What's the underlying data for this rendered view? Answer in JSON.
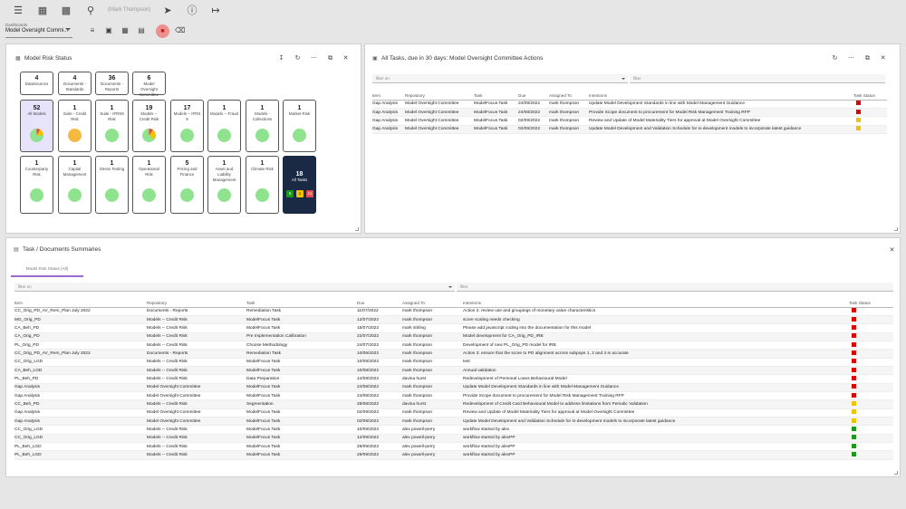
{
  "topbar": {
    "search_placeholder": "(Mark Thompson)",
    "icons": [
      "menu-icon",
      "dashboard-icon",
      "chart-icon",
      "search-icon",
      "nav-icon",
      "help-icon",
      "logout-icon"
    ]
  },
  "dashboard": {
    "label": "Dashboards",
    "value": "Model Oversight Commi..."
  },
  "risk_panel": {
    "title": "Model Risk Status",
    "summary": [
      {
        "count": "4",
        "label": "DataSources"
      },
      {
        "count": "4",
        "label": "Documents - Standards"
      },
      {
        "count": "36",
        "label": "Documents - Reports"
      },
      {
        "count": "6",
        "label": "Model Oversight Committee"
      }
    ],
    "tiles_row1": [
      {
        "count": "52",
        "label": "All Models"
      },
      {
        "count": "1",
        "label": "Suite - Credit Risk"
      },
      {
        "count": "1",
        "label": "Suite - IFRS9 Risk"
      },
      {
        "count": "19",
        "label": "Models -- Credit Risk"
      },
      {
        "count": "17",
        "label": "Models -- IFRS 9"
      },
      {
        "count": "1",
        "label": "Models -- Fraud"
      },
      {
        "count": "1",
        "label": "Models - Collections"
      },
      {
        "count": "1",
        "label": "Market Risk"
      }
    ],
    "tiles_row2": [
      {
        "count": "1",
        "label": "Counterparty Risk"
      },
      {
        "count": "1",
        "label": "Capital Management"
      },
      {
        "count": "1",
        "label": "Stress Testing"
      },
      {
        "count": "1",
        "label": "Operational Risk"
      },
      {
        "count": "5",
        "label": "Pricing and Finance"
      },
      {
        "count": "1",
        "label": "Asset and Liability Management"
      },
      {
        "count": "1",
        "label": "Climate Risk"
      }
    ],
    "all_tasks": {
      "count": "18",
      "label": "All Tasks",
      "green": "6",
      "yellow": "1",
      "red": "11"
    }
  },
  "tasks_panel": {
    "title": "All Tasks, due in 30 days: Model Oversight Committee Actions",
    "filter1": "filter on",
    "filter2": "filter",
    "columns": [
      "Item",
      "Repository",
      "Task",
      "Due",
      "Assigned To",
      "Intentions",
      "Task Status"
    ],
    "rows": [
      {
        "item": "Gap Analysis",
        "repo": "Model Oversight Committee",
        "task": "ModelFocus Task",
        "due": "24/08/2022",
        "assigned": "mark thompson",
        "intent": "Update Model Development Standards in line with Model Management Guidance",
        "status": "#e00000"
      },
      {
        "item": "Gap Analysis",
        "repo": "Model Oversight Committee",
        "task": "ModelFocus Task",
        "due": "24/08/2022",
        "assigned": "mark thompson",
        "intent": "Provide Scope document to procurement for Model Risk Management Training RFP",
        "status": "#e00000"
      },
      {
        "item": "Gap Analysis",
        "repo": "Model Oversight Committee",
        "task": "ModelFocus Task",
        "due": "02/09/2022",
        "assigned": "mark thompson",
        "intent": "Review and Update of Model Materiality Tiers for approval at Model Oversight Committee",
        "status": "#f2c200"
      },
      {
        "item": "Gap Analysis",
        "repo": "Model Oversight Committee",
        "task": "ModelFocus Task",
        "due": "02/09/2022",
        "assigned": "mark thompson",
        "intent": "Update Model Development and Validation Schedule for in-development models to incorporate latest guidance",
        "status": "#f2c200"
      }
    ]
  },
  "summary_panel": {
    "title": "Task / Documents Summaries",
    "tab": "Model Risk Status (All)",
    "filter1": "filter on",
    "filter2": "filter",
    "columns": [
      "Item",
      "Repository",
      "Task",
      "Due",
      "Assigned To",
      "Intentions",
      "Task Status"
    ],
    "rows": [
      {
        "item": "CC_Orig_PD_AV_Rem_Plan July 2022",
        "repo": "Documents - Reports",
        "task": "Remediation Task",
        "due": "11/07/2022",
        "assigned": "mark thompson",
        "intent": "Action 2: review use and groupings of monetary value characteristics",
        "status": "#e00000"
      },
      {
        "item": "MG_Orig_PD",
        "repo": "Models -- Credit Risk",
        "task": "ModelFocus Task",
        "due": "12/07/2022",
        "assigned": "mark thompson",
        "intent": "score scaling needs checking",
        "status": "#e00000"
      },
      {
        "item": "CA_Beh_PD",
        "repo": "Models -- Credit Risk",
        "task": "ModelFocus Task",
        "due": "15/07/2022",
        "assigned": "mark stirling",
        "intent": "Please add javascript coding into the documentation for this model",
        "status": "#e00000"
      },
      {
        "item": "CA_Orig_PD",
        "repo": "Models -- Credit Risk",
        "task": "Pre Implementation Calibration",
        "due": "22/07/2022",
        "assigned": "mark thompson",
        "intent": "Model development for CA_Orig_PD_IRB",
        "status": "#e00000"
      },
      {
        "item": "PL_Orig_PD",
        "repo": "Models -- Credit Risk",
        "task": "Choose Methodology",
        "due": "24/07/2022",
        "assigned": "mark thompson",
        "intent": "Development of new PL_Orig_PD model for IRB",
        "status": "#e00000"
      },
      {
        "item": "CC_Orig_PD_AV_Rem_Plan July 2022",
        "repo": "Documents - Reports",
        "task": "Remediation Task",
        "due": "10/08/2022",
        "assigned": "mark thompson",
        "intent": "Action 3: ensure that the score to PD alignment across subpops 1, 2 and 3 is accurate",
        "status": "#e00000"
      },
      {
        "item": "CC_Orig_LGD",
        "repo": "Models -- Credit Risk",
        "task": "ModelFocus Task",
        "due": "10/08/2022",
        "assigned": "mark thompson",
        "intent": "test",
        "status": "#e00000"
      },
      {
        "item": "CA_Beh_LGD",
        "repo": "Models -- Credit Risk",
        "task": "ModelFocus Task",
        "due": "10/08/2022",
        "assigned": "mark thompson",
        "intent": "Annual validation",
        "status": "#e00000"
      },
      {
        "item": "PL_Beh_PD",
        "repo": "Models -- Credit Risk",
        "task": "Data Preparation",
        "due": "14/08/2022",
        "assigned": "davina hurst",
        "intent": "Redevelopment of Personal Loans Behavioural Model",
        "status": "#e00000"
      },
      {
        "item": "Gap Analysis",
        "repo": "Model Oversight Committee",
        "task": "ModelFocus Task",
        "due": "24/08/2022",
        "assigned": "mark thompson",
        "intent": "Update Model Development Standards in line with Model Management Guidance",
        "status": "#e00000"
      },
      {
        "item": "Gap Analysis",
        "repo": "Model Oversight Committee",
        "task": "ModelFocus Task",
        "due": "24/08/2022",
        "assigned": "mark thompson",
        "intent": "Provide Scope document to procurement for Model Risk Management Training RFP",
        "status": "#e00000"
      },
      {
        "item": "CC_Beh_PD",
        "repo": "Models -- Credit Risk",
        "task": "Segmentation",
        "due": "29/08/2022",
        "assigned": "davina hurst",
        "intent": "Redevelopment of Credit Card Behavioural Model to address limitations from Periodic Validation",
        "status": "#f2c200"
      },
      {
        "item": "Gap Analysis",
        "repo": "Model Oversight Committee",
        "task": "ModelFocus Task",
        "due": "02/09/2022",
        "assigned": "mark thompson",
        "intent": "Review and Update of Model Materiality Tiers for approval at Model Oversight Committee",
        "status": "#f2c200"
      },
      {
        "item": "Gap Analysis",
        "repo": "Model Oversight Committee",
        "task": "ModelFocus Task",
        "due": "02/09/2022",
        "assigned": "mark thompson",
        "intent": "Update Model Development and Validation Schedule for in-development models to incorporate latest guidance",
        "status": "#f2c200"
      },
      {
        "item": "CC_Orig_LGD",
        "repo": "Models -- Credit Risk",
        "task": "ModelFocus Task",
        "due": "10/09/2022",
        "assigned": "alex powell-perry",
        "intent": "workflow started by alex",
        "status": "#1a9a1a"
      },
      {
        "item": "CC_Orig_LGD",
        "repo": "Models -- Credit Risk",
        "task": "ModelFocus Task",
        "due": "12/09/2022",
        "assigned": "alex powell-perry",
        "intent": "workflow started by alexPP",
        "status": "#1a9a1a"
      },
      {
        "item": "PL_Beh_LGD",
        "repo": "Models -- Credit Risk",
        "task": "ModelFocus Task",
        "due": "28/09/2022",
        "assigned": "alex powell-perry",
        "intent": "workflow started by alexPP",
        "status": "#1a9a1a"
      },
      {
        "item": "PL_Beh_LGD",
        "repo": "Models -- Credit Risk",
        "task": "ModelFocus Task",
        "due": "29/09/2022",
        "assigned": "alex powell-perry",
        "intent": "workflow started by alexPP",
        "status": "#1a9a1a"
      }
    ]
  }
}
